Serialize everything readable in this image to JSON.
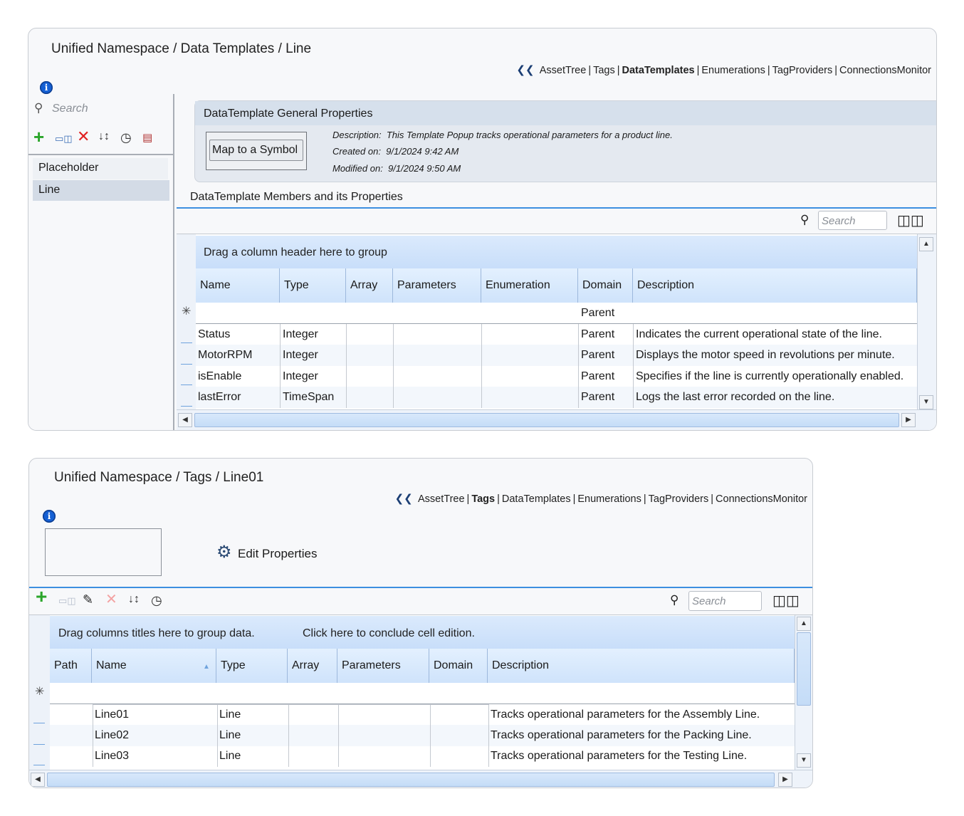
{
  "panel1": {
    "breadcrumb": "Unified Namespace / Data Templates / Line",
    "nav": {
      "assettree": "AssetTree",
      "tags": "Tags",
      "datatemplates": "DataTemplates",
      "enumerations": "Enumerations",
      "tagproviders": "TagProviders",
      "connectionsmonitor": "ConnectionsMonitor",
      "separator": "|",
      "active": "DataTemplates"
    },
    "sidebar": {
      "search_placeholder": "Search",
      "items": [
        {
          "label": "Placeholder",
          "selected": false
        },
        {
          "label": "Line",
          "selected": true
        }
      ]
    },
    "general": {
      "title": "DataTemplate General Properties",
      "map_button": "Map to a Symbol",
      "description": "Description:  This Template Popup tracks operational parameters for a product line.",
      "created": "Created on:  9/1/2024 9:42 AM",
      "modified": "Modified on:  9/1/2024 9:50 AM"
    },
    "members_title": "DataTemplate Members and its Properties",
    "grid": {
      "search_placeholder": "Search",
      "group_hint": "Drag a column header here to group",
      "columns": [
        "Name",
        "Type",
        "Array",
        "Parameters",
        "Enumeration",
        "Domain",
        "Description"
      ],
      "new_row_domain": "Parent",
      "new_row_marker": "✳",
      "rows": [
        {
          "name": "Status",
          "type": "Integer",
          "array": "",
          "parameters": "",
          "enumeration": "",
          "domain": "Parent",
          "description": "Indicates the current operational state of the line."
        },
        {
          "name": "MotorRPM",
          "type": "Integer",
          "array": "",
          "parameters": "",
          "enumeration": "",
          "domain": "Parent",
          "description": "Displays the motor speed in revolutions per minute."
        },
        {
          "name": "isEnable",
          "type": "Integer",
          "array": "",
          "parameters": "",
          "enumeration": "",
          "domain": "Parent",
          "description": "Specifies if the line is currently operationally enabled."
        },
        {
          "name": "lastError",
          "type": "TimeSpan",
          "array": "",
          "parameters": "",
          "enumeration": "",
          "domain": "Parent",
          "description": "Logs the last error recorded on the line."
        }
      ]
    }
  },
  "panel2": {
    "breadcrumb": "Unified Namespace / Tags / Line01",
    "nav": {
      "assettree": "AssetTree",
      "tags": "Tags",
      "datatemplates": "DataTemplates",
      "enumerations": "Enumerations",
      "tagproviders": "TagProviders",
      "connectionsmonitor": "ConnectionsMonitor",
      "separator": "|",
      "active": "Tags"
    },
    "edit_properties": "Edit Properties",
    "grid": {
      "search_placeholder": "Search",
      "group_hint": "Drag columns titles here to group data.",
      "conclude_hint": "Click here to conclude cell edition.",
      "columns": [
        "Path",
        "Name",
        "Type",
        "Array",
        "Parameters",
        "Domain",
        "Description"
      ],
      "sort_column": "Name",
      "new_row_marker": "✳",
      "rows": [
        {
          "path": "",
          "name": "Line01",
          "type": "Line",
          "array": "",
          "parameters": "",
          "domain": "",
          "description": "Tracks operational parameters for the Assembly Line."
        },
        {
          "path": "",
          "name": "Line02",
          "type": "Line",
          "array": "",
          "parameters": "",
          "domain": "",
          "description": "Tracks operational parameters for the Packing Line."
        },
        {
          "path": "",
          "name": "Line03",
          "type": "Line",
          "array": "",
          "parameters": "",
          "domain": "",
          "description": "Tracks operational parameters for the Testing Line."
        }
      ]
    }
  },
  "colors": {
    "accent": "#3d8fe0",
    "header_blue": "#cfe3fb",
    "selected_item": "#d3dbe6",
    "add_green": "#2aa52a",
    "delete_red": "#e02020",
    "info_blue": "#1560d4"
  }
}
